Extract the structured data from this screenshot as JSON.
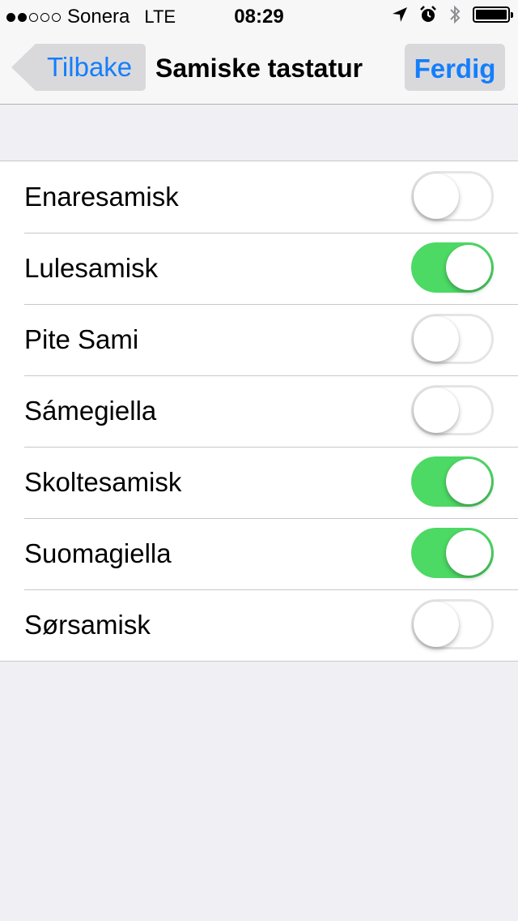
{
  "status_bar": {
    "carrier": "Sonera",
    "network": "LTE",
    "time": "08:29",
    "signal_bars_filled": 2,
    "signal_bars_total": 5
  },
  "nav": {
    "back_label": "Tilbake",
    "title": "Samiske tastatur",
    "done_label": "Ferdig"
  },
  "colors": {
    "accent": "#157efb",
    "switch_on": "#4cd964",
    "background": "#efeff4"
  },
  "keyboards": [
    {
      "label": "Enaresamisk",
      "on": false
    },
    {
      "label": "Lulesamisk",
      "on": true
    },
    {
      "label": "Pite Sami",
      "on": false
    },
    {
      "label": "Sámegiella",
      "on": false
    },
    {
      "label": "Skoltesamisk",
      "on": true
    },
    {
      "label": "Suomagiella",
      "on": true
    },
    {
      "label": "Sørsamisk",
      "on": false
    }
  ]
}
